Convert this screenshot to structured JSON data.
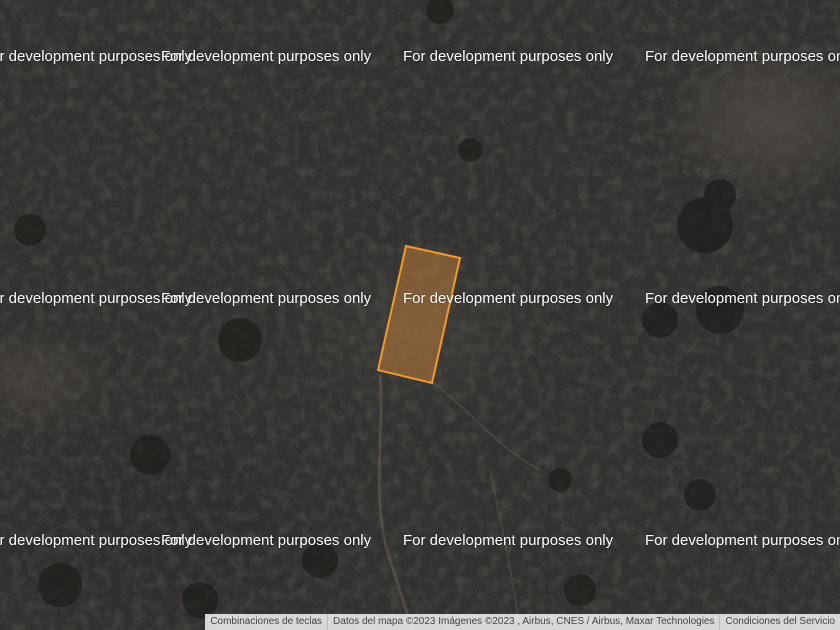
{
  "map": {
    "watermark": "For development purposes only",
    "parcel": {
      "stroke": "#f39a2e",
      "fill": "#b87a38"
    },
    "attribution": {
      "shortcuts": "Combinaciones de teclas",
      "map_data": "Datos del mapa ©2023 Imágenes ©2023 , Airbus, CNES / Airbus, Maxar Technologies",
      "terms": "Condiciones del Servicio"
    }
  }
}
